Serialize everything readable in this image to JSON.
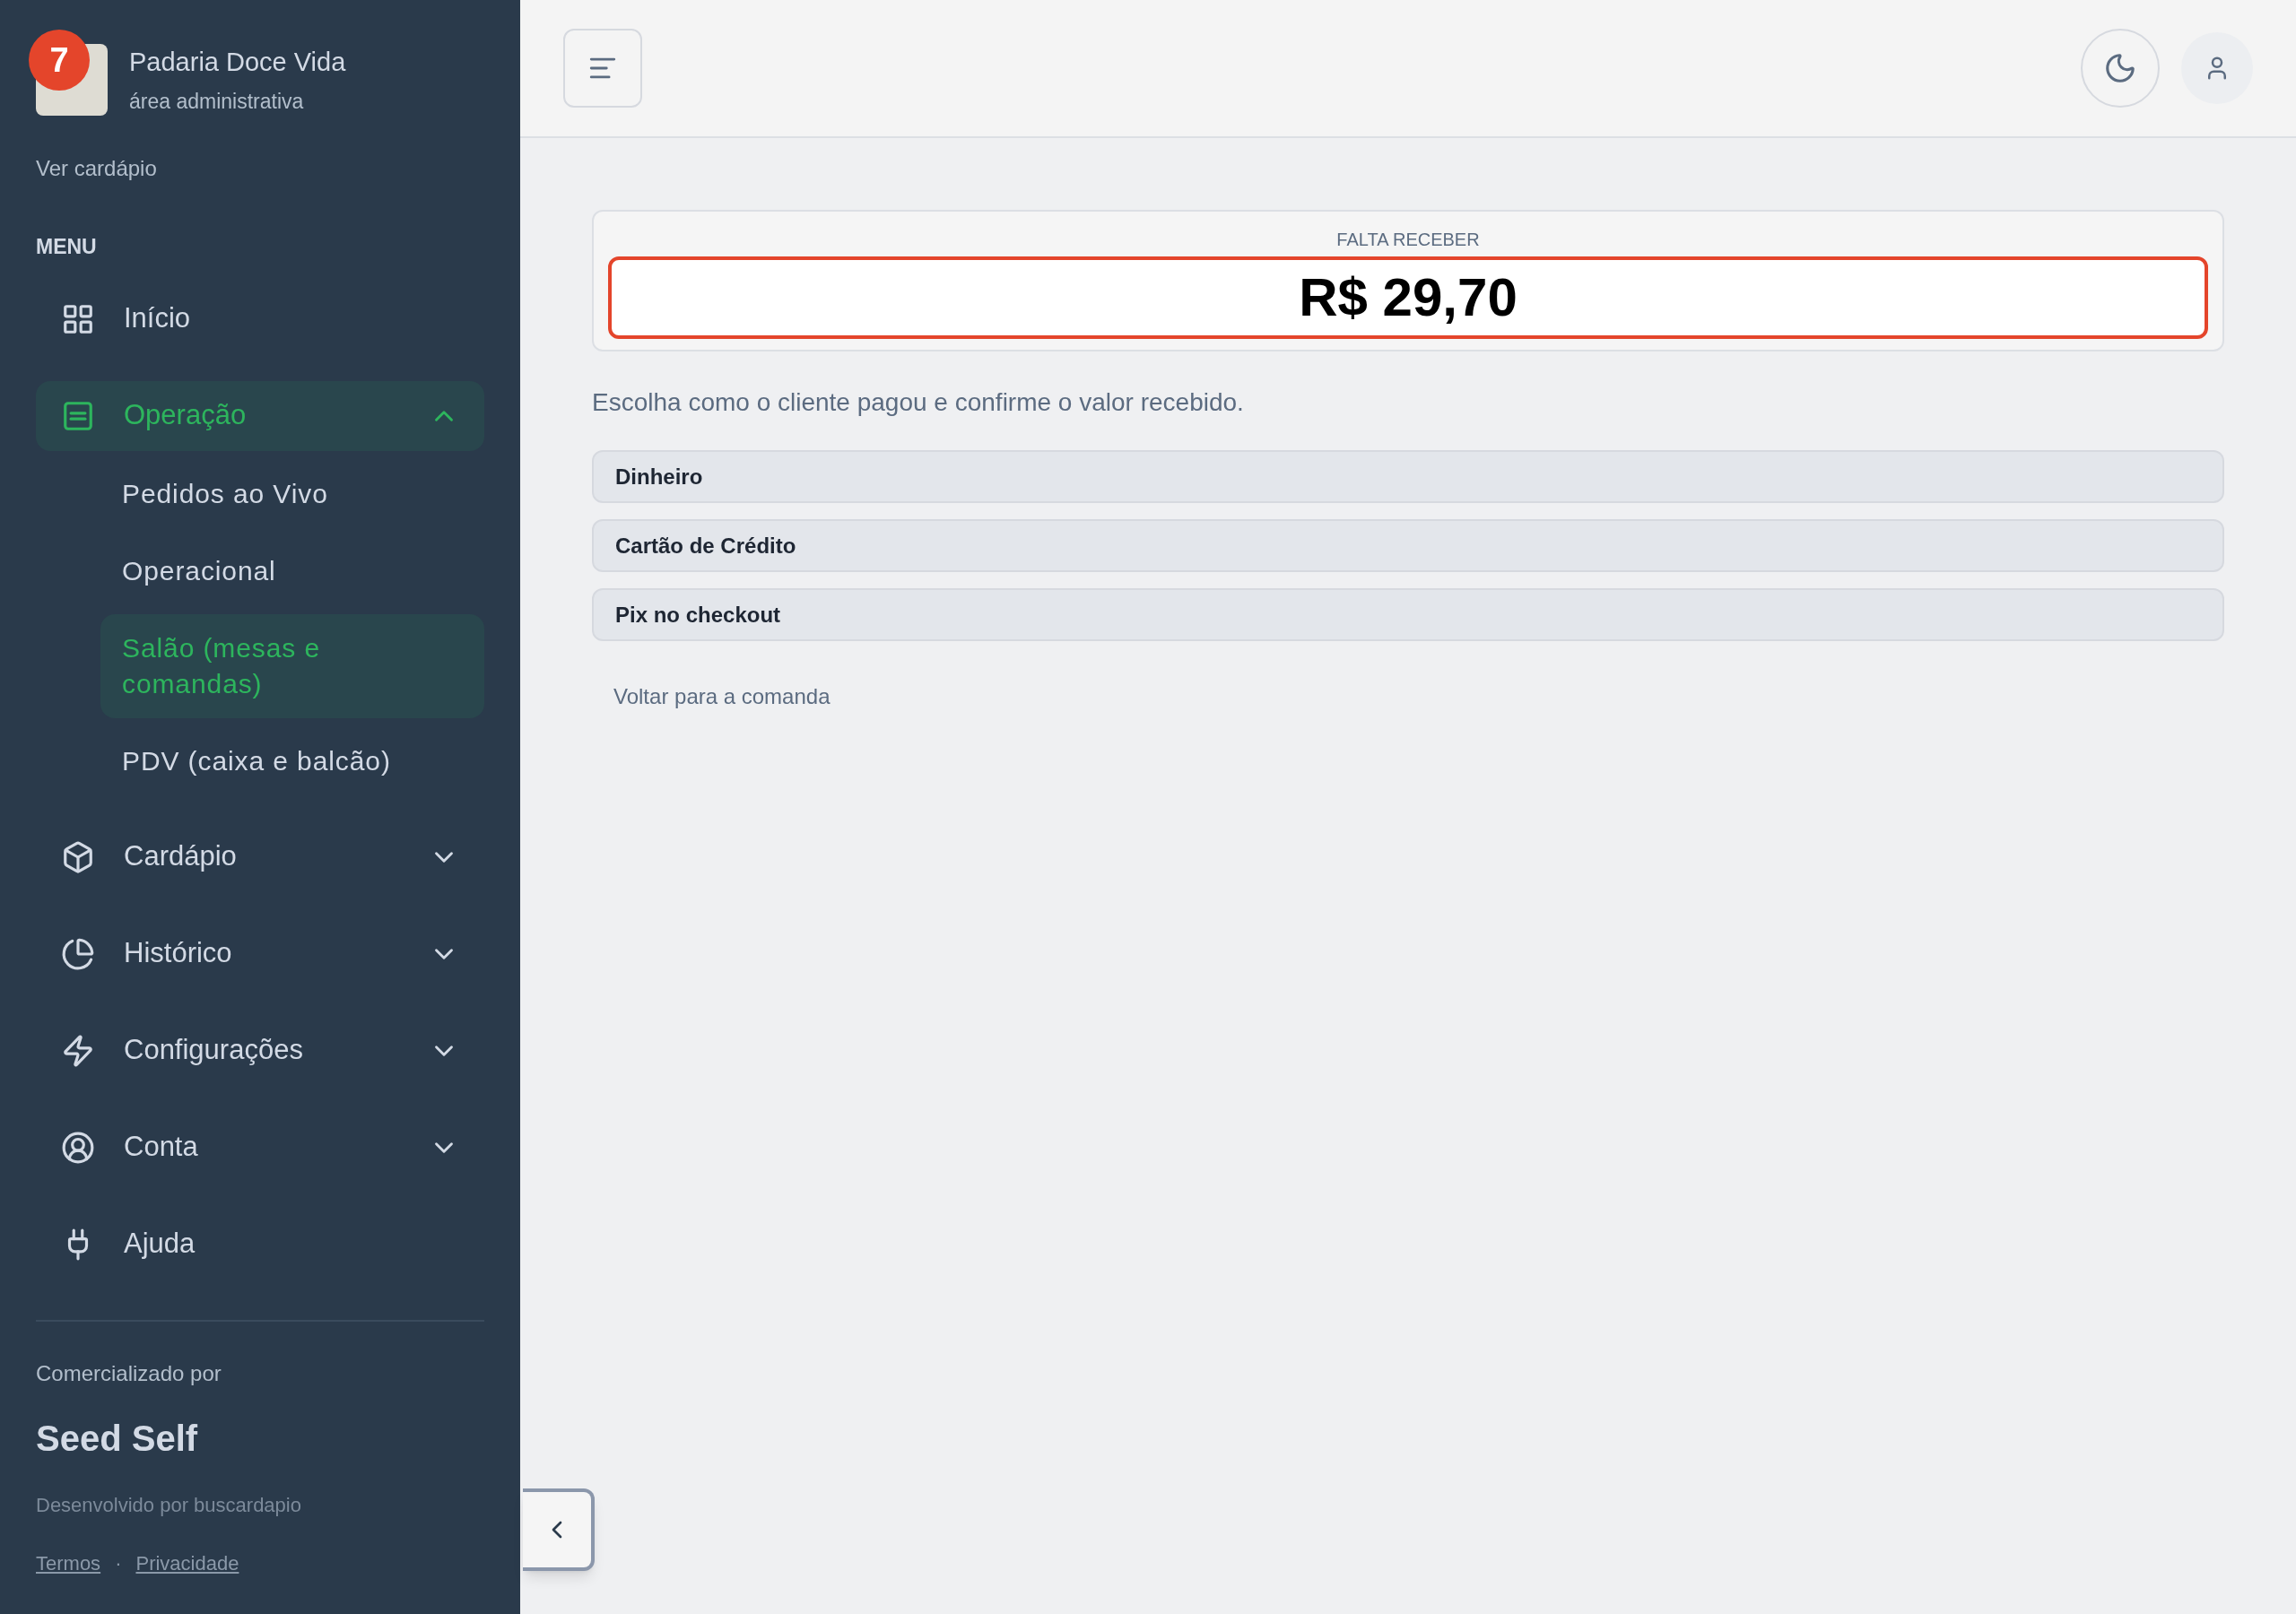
{
  "sidebar": {
    "badge": "7",
    "store_name": "Padaria Doce Vida",
    "store_subtitle": "área administrativa",
    "menu_link": "Ver cardápio",
    "section_title": "MENU",
    "items": [
      {
        "kind": "link",
        "label": "Início",
        "selected": false
      },
      {
        "kind": "group",
        "label": "Operação",
        "selected": true,
        "expanded": true,
        "children": [
          {
            "label": "Pedidos ao Vivo",
            "selected": false
          },
          {
            "label": "Operacional",
            "selected": false
          },
          {
            "label": "Salão (mesas e comandas)",
            "selected": true
          },
          {
            "label": "PDV (caixa e balcão)",
            "selected": false
          }
        ]
      },
      {
        "kind": "group",
        "label": "Cardápio",
        "selected": false,
        "expanded": false
      },
      {
        "kind": "group",
        "label": "Histórico",
        "selected": false,
        "expanded": false
      },
      {
        "kind": "group",
        "label": "Configurações",
        "selected": false,
        "expanded": false
      },
      {
        "kind": "group",
        "label": "Conta",
        "selected": false,
        "expanded": false
      },
      {
        "kind": "link",
        "label": "Ajuda",
        "selected": false
      }
    ],
    "footer": {
      "caption": "Comercializado por",
      "brand": "Seed Self",
      "developer": "Desenvolvido por buscardapio",
      "links": [
        "Termos",
        "Privacidade"
      ],
      "separator": "·"
    }
  },
  "payment": {
    "amount_label": "FALTA RECEBER",
    "amount": "R$ 29,70",
    "instruction": "Escolha como o cliente pagou e confirme o valor recebido.",
    "methods": [
      "Dinheiro",
      "Cartão de Crédito",
      "Pix no checkout"
    ],
    "back_link": "Voltar para a comanda"
  }
}
